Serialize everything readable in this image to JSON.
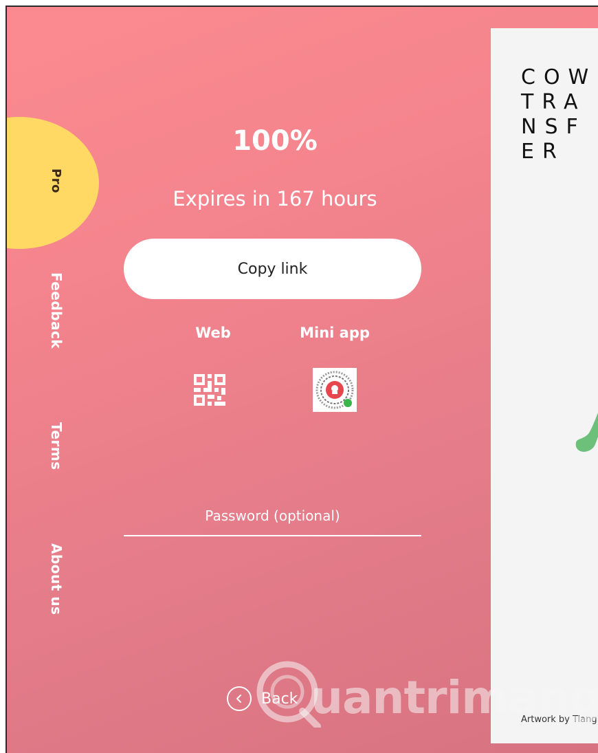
{
  "sidebar": {
    "pro": "Pro",
    "feedback": "Feedback",
    "terms": "Terms",
    "about": "About us"
  },
  "transfer": {
    "progress_text": "100%",
    "expires": "Expires in 167 hours",
    "copy_link": "Copy link",
    "web_label": "Web",
    "mini_app_label": "Mini app",
    "password_placeholder": "Password (optional)",
    "back": "Back"
  },
  "card": {
    "logo_lines": [
      "COW",
      "TRA",
      "NSF",
      "ER"
    ],
    "artwork_credit": "Artwork by Tiang"
  },
  "watermark": {
    "text": "uantrimang"
  },
  "colors": {
    "background_top": "#fb8a90",
    "background_bottom": "#d77381",
    "pro_badge": "#ffd964",
    "card": "#f4f4f4",
    "accent_green": "#6cc07a"
  },
  "icons": {
    "web_qr": "qr-code-icon",
    "mini_app_qr": "mini-app-code-icon",
    "back": "chevron-left-icon"
  }
}
